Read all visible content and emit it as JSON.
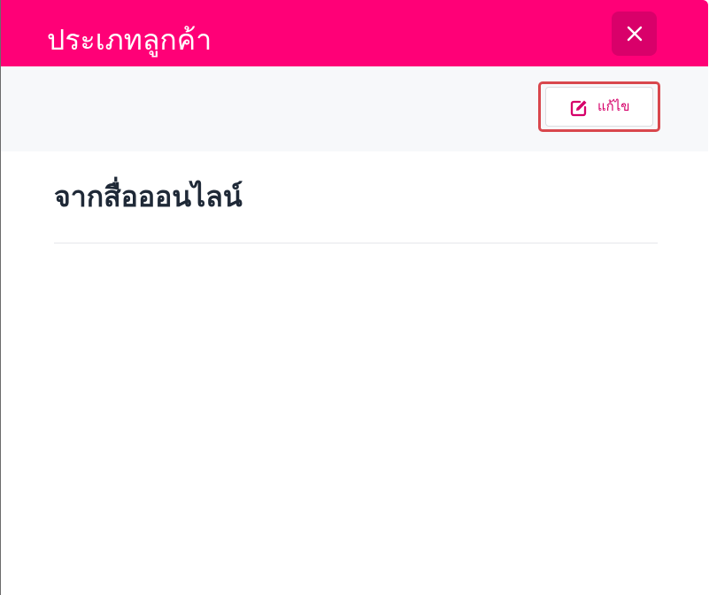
{
  "modal": {
    "title": "ประเภทลูกค้า",
    "close_icon": "close-icon"
  },
  "toolbar": {
    "edit_label": "แก้ไข",
    "edit_icon": "edit-icon"
  },
  "content": {
    "value": "จากสื่อออนไลน์"
  },
  "colors": {
    "header": "#ff0077",
    "close_button": "#d9006a",
    "accent_text": "#d6006a",
    "highlight_border": "#d9474d",
    "toolbar_bg": "#f7f8fa",
    "text": "#1f2937"
  }
}
